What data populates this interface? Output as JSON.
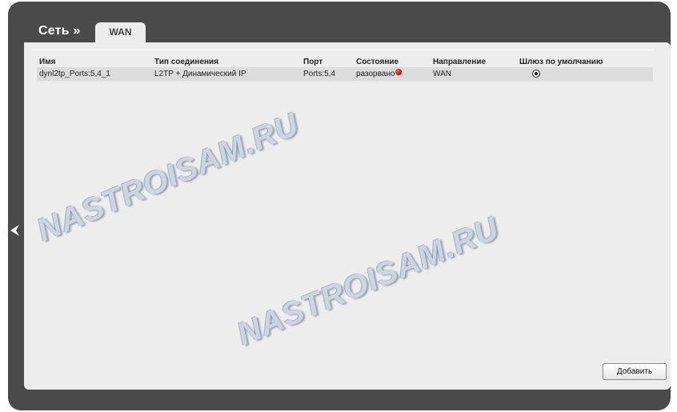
{
  "header": {
    "breadcrumb": "Сеть »",
    "active_tab": "WAN"
  },
  "table": {
    "columns": [
      "Имя",
      "Тип соединения",
      "Порт",
      "Состояние",
      "Направление",
      "Шлюз по умолчанию"
    ],
    "rows": [
      {
        "name": "dynl2tp_Ports:5,4_1",
        "type": "L2TP + Динамический IP",
        "port": "Ports:5,4",
        "status": "разорвано",
        "status_color": "#d01010",
        "direction": "WAN",
        "default_gateway": true
      }
    ]
  },
  "buttons": {
    "add": "Добавить"
  },
  "watermark": {
    "text": "NASTROISAM.RU"
  },
  "colors": {
    "frame": "#4a4a4a",
    "panel": "#ededed",
    "row": "#dcdcdc"
  },
  "icons": {
    "back": "back-arrow-icon",
    "status": "status-dot-icon",
    "radio": "radio-selected-icon"
  }
}
